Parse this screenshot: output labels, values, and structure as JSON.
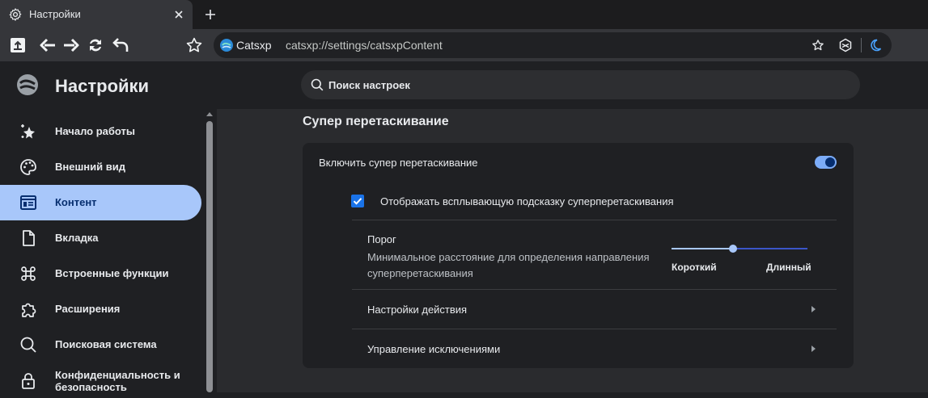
{
  "tab": {
    "title": "Настройки",
    "icon": "gear-icon",
    "close_icon": "close-icon"
  },
  "toolbar": {
    "new_tab_icon": "plus-icon",
    "buttons": [
      "upload-icon",
      "back-arrow-icon",
      "forward-arrow-icon",
      "reload-icon",
      "undo-icon",
      "bookmark-star-icon"
    ]
  },
  "omnibox": {
    "site_name": "Catsxp",
    "url": "catsxp://settings/catsxpContent"
  },
  "header": {
    "title": "Настройки",
    "search_placeholder": "Поиск настроек"
  },
  "sidebar": {
    "items": [
      {
        "label": "Начало работы",
        "icon": "sparkle-star-icon"
      },
      {
        "label": "Внешний вид",
        "icon": "palette-icon"
      },
      {
        "label": "Контент",
        "icon": "content-window-icon",
        "active": true
      },
      {
        "label": "Вкладка",
        "icon": "document-icon"
      },
      {
        "label": "Встроенные функции",
        "icon": "command-icon"
      },
      {
        "label": "Расширения",
        "icon": "puzzle-icon"
      },
      {
        "label": "Поисковая система",
        "icon": "search-icon"
      },
      {
        "label": "Конфиденциальность и безопасность",
        "icon": "lock-icon"
      }
    ]
  },
  "main": {
    "section_title": "Супер перетаскивание",
    "enable_label": "Включить супер перетаскивание",
    "enable_on": true,
    "tooltip_label": "Отображать всплывающую подсказку суперперетаскивания",
    "tooltip_checked": true,
    "threshold": {
      "label": "Порог",
      "description": "Минимальное расстояние для определения направления суперперетаскивания",
      "min_label": "Короткий",
      "max_label": "Длинный",
      "value_fraction": 0.45
    },
    "action_settings_label": "Настройки действия",
    "exceptions_label": "Управление исключениями"
  },
  "colors": {
    "accent": "#a8c7fa",
    "accent_dark": "#062e6f",
    "checkbox": "#1a73e8"
  }
}
